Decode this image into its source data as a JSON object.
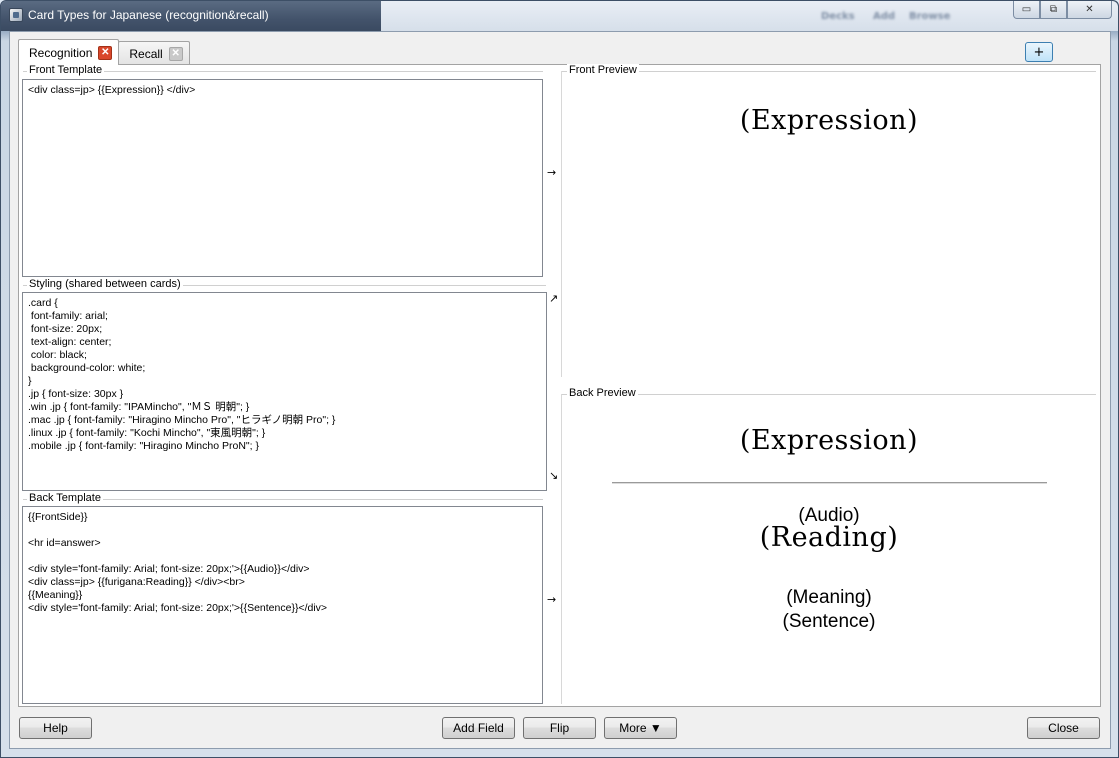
{
  "window": {
    "title": "Card Types for Japanese (recognition&recall)",
    "background_blur_text": [
      "Decks",
      "Add",
      "Browse"
    ]
  },
  "tabs": [
    {
      "label": "Recognition",
      "active": true
    },
    {
      "label": "Recall",
      "active": false
    }
  ],
  "add_tab_label": "+",
  "front_template": {
    "label": "Front Template",
    "content": "<div class=jp> {{Expression}} </div>"
  },
  "styling": {
    "label": "Styling (shared between cards)",
    "content": ".card {\n font-family: arial;\n font-size: 20px;\n text-align: center;\n color: black;\n background-color: white;\n}\n.jp { font-size: 30px }\n.win .jp { font-family: \"IPAMincho\", \"ＭＳ 明朝\"; }\n.mac .jp { font-family: \"Hiragino Mincho Pro\", \"ヒラギノ明朝 Pro\"; }\n.linux .jp { font-family: \"Kochi Mincho\", \"東風明朝\"; }\n.mobile .jp { font-family: \"Hiragino Mincho ProN\"; }"
  },
  "back_template": {
    "label": "Back Template",
    "content": "{{FrontSide}}\n\n<hr id=answer>\n\n<div style='font-family: Arial; font-size: 20px;'>{{Audio}}</div>\n<div class=jp> {{furigana:Reading}} </div><br>\n{{Meaning}}\n<div style='font-family: Arial; font-size: 20px;'>{{Sentence}}</div>"
  },
  "arrows": {
    "front": "→",
    "styling_up": "↗",
    "styling_down": "↘",
    "back": "→"
  },
  "front_preview": {
    "label": "Front Preview",
    "expression": "(Expression)"
  },
  "back_preview": {
    "label": "Back Preview",
    "expression": "(Expression)",
    "audio": "(Audio)",
    "reading": "(Reading)",
    "meaning": "(Meaning)",
    "sentence": "(Sentence)"
  },
  "buttons": {
    "help": "Help",
    "add_field": "Add Field",
    "flip": "Flip",
    "more": "More ▼",
    "close": "Close"
  },
  "window_controls": {
    "minimize": "▭",
    "maximize": "⧉",
    "close": "✕"
  }
}
